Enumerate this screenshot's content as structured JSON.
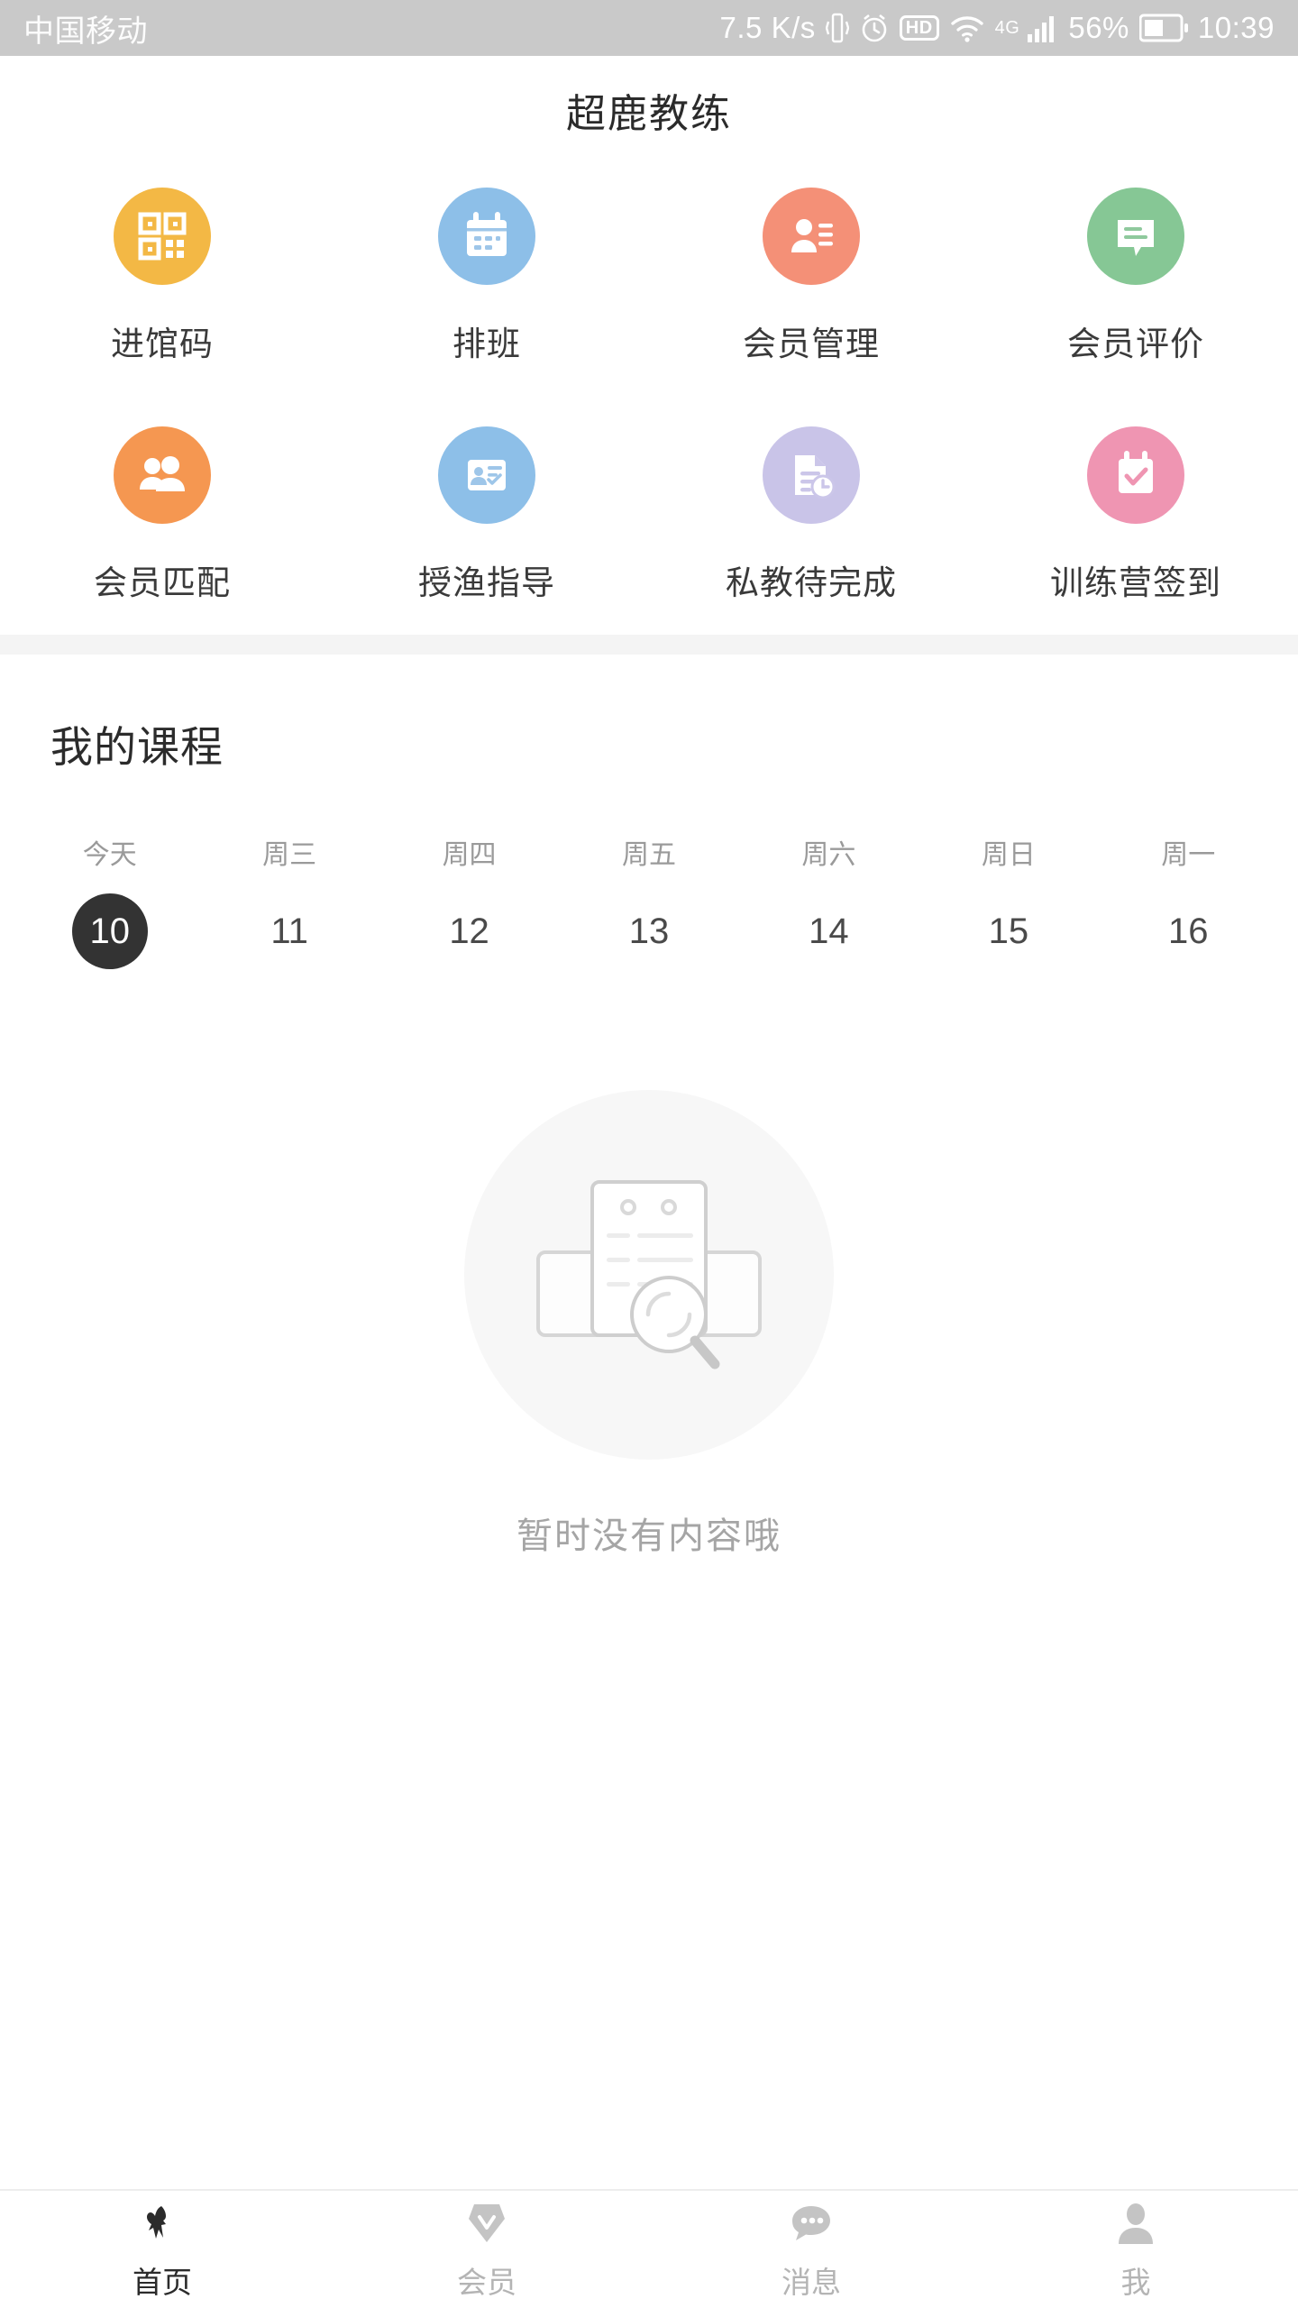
{
  "status_bar": {
    "carrier": "中国移动",
    "network_speed": "7.5 K/s",
    "vibrate_icon": "vibrate-icon",
    "alarm_icon": "alarm-icon",
    "hd_badge": "HD",
    "wifi_icon": "wifi-icon",
    "mobile_network": "4G",
    "signal_icon": "signal-bars-icon",
    "battery_percent": "56%",
    "battery_icon": "battery-icon",
    "clock": "10:39"
  },
  "header": {
    "title": "超鹿教练"
  },
  "quick_actions": [
    {
      "label": "进馆码",
      "icon": "qrcode-icon",
      "color": "#f3b845"
    },
    {
      "label": "排班",
      "icon": "calendar-icon",
      "color": "#8dbfe8"
    },
    {
      "label": "会员管理",
      "icon": "member-list-icon",
      "color": "#f49077"
    },
    {
      "label": "会员评价",
      "icon": "comment-icon",
      "color": "#86c795"
    },
    {
      "label": "会员匹配",
      "icon": "two-people-icon",
      "color": "#f59751"
    },
    {
      "label": "授渔指导",
      "icon": "id-card-icon",
      "color": "#8dbfe8"
    },
    {
      "label": "私教待完成",
      "icon": "document-clock-icon",
      "color": "#c9c4e8"
    },
    {
      "label": "训练营签到",
      "icon": "calendar-check-icon",
      "color": "#ef95b2"
    }
  ],
  "my_courses": {
    "title": "我的课程",
    "days": [
      {
        "name": "今天",
        "date": "10",
        "selected": true
      },
      {
        "name": "周三",
        "date": "11",
        "selected": false
      },
      {
        "name": "周四",
        "date": "12",
        "selected": false
      },
      {
        "name": "周五",
        "date": "13",
        "selected": false
      },
      {
        "name": "周六",
        "date": "14",
        "selected": false
      },
      {
        "name": "周日",
        "date": "15",
        "selected": false
      },
      {
        "name": "周一",
        "date": "16",
        "selected": false
      }
    ],
    "empty_state": {
      "text": "暂时没有内容哦",
      "illustration": "document-search-empty-icon"
    },
    "selected_accent": "#333333"
  },
  "tabbar": [
    {
      "label": "首页",
      "icon": "deer-logo-icon",
      "active": true
    },
    {
      "label": "会员",
      "icon": "diamond-icon",
      "active": false
    },
    {
      "label": "消息",
      "icon": "chat-bubble-icon",
      "active": false
    },
    {
      "label": "我",
      "icon": "person-icon",
      "active": false
    }
  ]
}
